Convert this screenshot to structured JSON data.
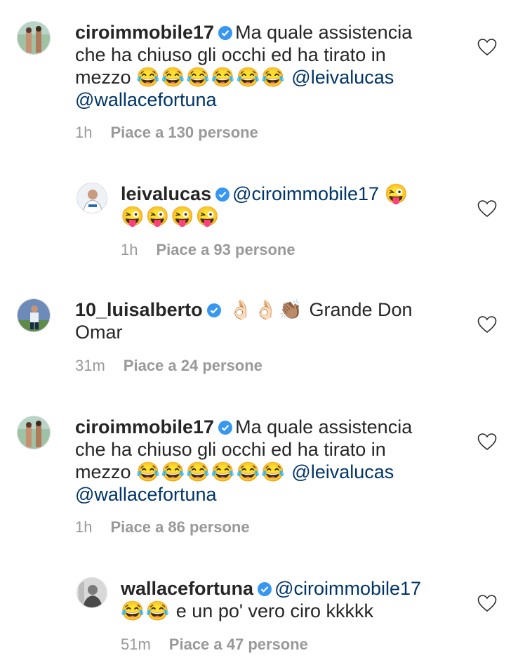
{
  "comments": [
    {
      "username": "ciroimmobile17",
      "text_line1": "Ma quale assistencia",
      "text_line2": "che ha chiuso gli occhi ed ha tirato in",
      "text_line3_prefix": "mezzo",
      "emoji": "😂😂😂😂😂😂",
      "mention1": "@leivalucas",
      "mention2": "@wallacefortuna",
      "time": "1h",
      "likes": "Piace a 130 persone"
    },
    {
      "username": "leivalucas",
      "mention": "@ciroimmobile17",
      "emoji_inline": "😜",
      "emoji_line2": "😜😜😜😜",
      "time": "1h",
      "likes": "Piace a 93 persone"
    },
    {
      "username": "10_luisalberto",
      "emoji": "👌🏻👌🏻👏🏽",
      "text_inline": "Grande Don",
      "text_line2": "Omar",
      "time": "31m",
      "likes": "Piace a 24 persone"
    },
    {
      "username": "ciroimmobile17",
      "text_line1": "Ma quale assistencia",
      "text_line2": "che ha chiuso gli occhi ed ha tirato in",
      "text_line3_prefix": "mezzo",
      "emoji": "😂😂😂😂😂😂",
      "mention1": "@leivalucas",
      "mention2": "@wallacefortuna",
      "time": "1h",
      "likes": "Piace a 86 persone"
    },
    {
      "username": "wallacefortuna",
      "mention": "@ciroimmobile17",
      "emoji": "😂😂",
      "text": "e un po' vero ciro kkkkk",
      "time": "51m",
      "likes": "Piace a 47 persone"
    }
  ],
  "icons": {
    "verified": "verified-badge-icon",
    "like": "heart-outline-icon"
  },
  "colors": {
    "text": "#262626",
    "mention": "#003569",
    "meta": "#999999",
    "verified": "#3897f0"
  }
}
